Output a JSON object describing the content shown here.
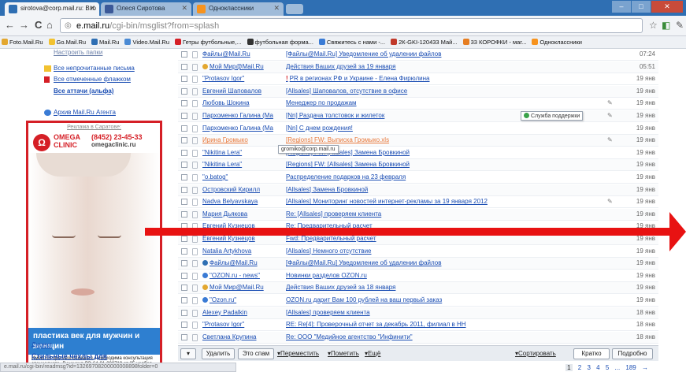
{
  "tabs": [
    {
      "title": "sirotova@corp.mail.ru: Вхо",
      "fav_color": "#2f6fb3"
    },
    {
      "title": "Олеся Сиротова",
      "fav_color": "#3b5998"
    },
    {
      "title": "Одноклассники",
      "fav_color": "#f7931e"
    }
  ],
  "window_controls": [
    "–",
    "□",
    "✕"
  ],
  "toolbar": {
    "back": "←",
    "forward": "→",
    "reload": "C",
    "home": "⌂",
    "url_host": "e.mail.ru",
    "url_path": "/cgi-bin/msglist?from=splash",
    "star": "☆"
  },
  "bookmarks": [
    {
      "label": "Foto.Mail.Ru",
      "color": "#e3a72f"
    },
    {
      "label": "Go.Mail.Ru",
      "color": "#f2c230"
    },
    {
      "label": "Mail.Ru",
      "color": "#2f6fb3"
    },
    {
      "label": "Video.Mail.Ru",
      "color": "#4a8ad4"
    },
    {
      "label": "Гетры футбольные,...",
      "color": "#d51f26"
    },
    {
      "label": "футбольная форма...",
      "color": "#333333"
    },
    {
      "label": "Свяжитесь с нами -...",
      "color": "#3a7bd5"
    },
    {
      "label": "2К-GKI-120433 Май...",
      "color": "#c0392b"
    },
    {
      "label": "33 КОРОФКИ - маг...",
      "color": "#e67e22"
    },
    {
      "label": "Одноклассники",
      "color": "#f7931e"
    }
  ],
  "sidebar": {
    "settings_link": "Настроить папки",
    "unread": "Все непрочитанные письма",
    "flagged": "Все отмеченные флажком",
    "attachments": "Все аттачи (альфа)",
    "agent_archive": "Архив Mail.Ru Агента",
    "direct": "Директ",
    "promo": "Стильные чехлы для"
  },
  "ad": {
    "title": "Реклама в Саратове:",
    "logo": "Ω",
    "brand_line1": "OMEGA",
    "brand_line2": "CLINIC",
    "phone": "(8452) 23-45-33",
    "site": "omegaclinic.ru",
    "band": "пластика век для мужчин и женщин",
    "fine": "Имеются противопоказания, необходима консультация специалиста. Лицензия ЛО-64-01-000719 от 25 ноября 2009"
  },
  "mail_rows": [
    {
      "from": "Файлы@Mail.Ru",
      "subject": "[Файлы@Mail.Ru] Уведомление об удалении файлов",
      "date": "07:24",
      "style": "normal",
      "icon": ""
    },
    {
      "from": "Мой Мир@Mail.Ru",
      "subject": "Действия Ваших друзей за 19 января",
      "date": "05:51",
      "style": "normal",
      "icon": "#e3a72f"
    },
    {
      "from": "\"Protasov Igor\"",
      "subject": "PR в регионах РФ и Украине - Елена Фирюлина",
      "date": "19 янв",
      "style": "excl",
      "icon": ""
    },
    {
      "from": "Евгений Шаповалов",
      "subject": "[Allsales] Шаповалов, отсутствие в офисе",
      "date": "19 янв",
      "style": "normal",
      "icon": ""
    },
    {
      "from": "Любовь Шокина",
      "subject": "Менеджер по продажам",
      "date": "19 янв",
      "style": "clip",
      "icon": ""
    },
    {
      "from": "Пархоменко Галина (Ма",
      "subject": "[Nn] Раздача толстовок и жилеток",
      "date": "19 янв",
      "style": "clip",
      "icon": ""
    },
    {
      "from": "Пархоменко Галина (Ма",
      "subject": "[Nn] С днем рождения!",
      "date": "19 янв",
      "style": "normal",
      "icon": ""
    },
    {
      "from": "Ирина Громыко",
      "subject": "[Regions] FW: Выписка Громыко.xls",
      "date": "19 янв",
      "style": "orange-clip",
      "icon": ""
    },
    {
      "from": "\"Nikitina Lera\"",
      "subject": "[Regions] FW: [Allsales] Замена Бровкиной",
      "date": "19 янв",
      "style": "normal",
      "icon": ""
    },
    {
      "from": "\"Nikitina Lera\"",
      "subject": "[Regions] FW: [Allsales] Замена Бровкиной",
      "date": "19 янв",
      "style": "normal",
      "icon": ""
    },
    {
      "from": "\"o.batog\"",
      "subject": "Распределение подарков на 23 февраля",
      "date": "19 янв",
      "style": "normal",
      "icon": ""
    },
    {
      "from": "Островский Кирилл",
      "subject": "[Allsales] Замена Бровкиной",
      "date": "19 янв",
      "style": "normal",
      "icon": ""
    },
    {
      "from": "Nadva Belyavskaya",
      "subject": "[Allsales] Мониторинг новостей интернет-рекламы за 19 января 2012",
      "date": "19 янв",
      "style": "clip",
      "icon": ""
    },
    {
      "from": "Мария Дьякова",
      "subject": "Re: [Allsales] проверяем клиента",
      "date": "19 янв",
      "style": "normal",
      "icon": ""
    },
    {
      "from": "Евгений Кузнецов",
      "subject": "Re: Предварительный расчет",
      "date": "19 янв",
      "style": "normal",
      "icon": ""
    },
    {
      "from": "Евгений Кузнецов",
      "subject": "Fwd: Предварительный расчет",
      "date": "19 янв",
      "style": "normal",
      "icon": ""
    },
    {
      "from": "Natalia Artykhova",
      "subject": "[Allsales] Немного отсутствие",
      "date": "19 янв",
      "style": "normal",
      "icon": ""
    },
    {
      "from": "Файлы@Mail.Ru",
      "subject": "[Файлы@Mail.Ru] Уведомление об удалении файлов",
      "date": "19 янв",
      "style": "normal",
      "icon": "#2f6fb3"
    },
    {
      "from": "\"OZON.ru - news\"",
      "subject": "Новинки разделов OZON.ru",
      "date": "19 янв",
      "style": "normal",
      "icon": "#3a7bd5"
    },
    {
      "from": "Мой Мир@Mail.Ru",
      "subject": "Действия Ваших друзей за 18 января",
      "date": "19 янв",
      "style": "normal",
      "icon": "#e3a72f"
    },
    {
      "from": "\"Ozon.ru\"",
      "subject": "OZON.ru дарит Вам 100 рублей на ваш первый заказ",
      "date": "19 янв",
      "style": "normal",
      "icon": "#3a7bd5"
    },
    {
      "from": "Alexey Padalkin",
      "subject": "[Allsales] проверяем клиента",
      "date": "18 янв",
      "style": "normal",
      "icon": ""
    },
    {
      "from": "\"Protasov Igor\"",
      "subject": "RE: Re[4]: Проверочный отчет за декабрь 2011, филиал в НН",
      "date": "18 янв",
      "style": "normal",
      "icon": ""
    },
    {
      "from": "Светлана Крупина",
      "subject": "Re: ООО \"Медийное агентство \"Инфинити\"",
      "date": "18 янв",
      "style": "normal",
      "icon": ""
    }
  ],
  "tooltips": {
    "support": "Служба поддержки",
    "email": "gromiko@corp.mail.ru"
  },
  "actions": {
    "delete": "Удалить",
    "spam": "Это спам",
    "move": "▾Переместить",
    "mark": "▾Пометить",
    "more": "▾Ещё",
    "sort": "▾Сортировать",
    "brief": "Кратко",
    "detailed": "Подробно"
  },
  "status_url": "e.mail.ru/cgi-bin/readmsg?id=13269708200000008898folder=0",
  "pager": [
    "1",
    "2",
    "3",
    "4",
    "5",
    "...",
    "189",
    "→"
  ],
  "colors": {
    "accent_red": "#e81212",
    "link_blue": "#1a4db3",
    "orange": "#e8783a"
  }
}
